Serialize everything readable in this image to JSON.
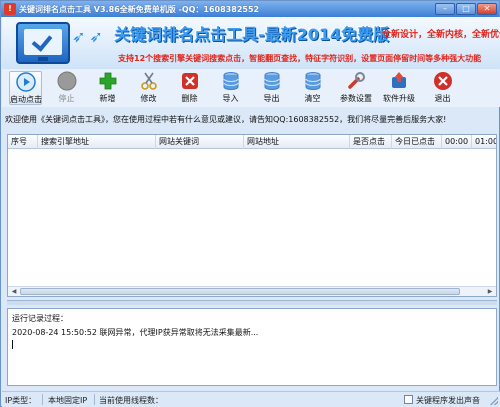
{
  "window": {
    "title": "关键词排名点击工具  V3.86全新免费单机版  -QQ：1608382552",
    "controls": {
      "minimize": "–",
      "maximize": "□",
      "close": "✕"
    }
  },
  "banner": {
    "title": "关键词排名点击工具-最新2014免费版",
    "tagline": "全新设计，全新内核，全新优化",
    "subtitle": "支持12个搜索引擎关键词搜索点击，智能翻页查找，特征字符识别，设置页面停留时间等多种强大功能"
  },
  "toolbar": {
    "items": [
      {
        "label": "启动点击",
        "icon": "play-icon",
        "color": "#1e7fd6"
      },
      {
        "label": "停止",
        "icon": "stop-icon",
        "color": "#8a8a8a"
      },
      {
        "label": "新增",
        "icon": "plus-icon",
        "color": "#2aa52a"
      },
      {
        "label": "修改",
        "icon": "scissors-icon",
        "color": "#c89a1a"
      },
      {
        "label": "删除",
        "icon": "delete-icon",
        "color": "#d0302a"
      },
      {
        "label": "导入",
        "icon": "database-import-icon",
        "color": "#3c7fd0"
      },
      {
        "label": "导出",
        "icon": "database-export-icon",
        "color": "#3c7fd0"
      },
      {
        "label": "清空",
        "icon": "database-clear-icon",
        "color": "#3c7fd0"
      },
      {
        "label": "参数设置",
        "icon": "wrench-icon",
        "color": "#cc3a2a"
      },
      {
        "label": "软件升级",
        "icon": "upgrade-icon",
        "color": "#2f6fc0"
      },
      {
        "label": "退出",
        "icon": "exit-icon",
        "color": "#d0302a"
      }
    ]
  },
  "welcome": "欢迎使用《关键词点击工具》，您在使用过程中若有什么意见或建议，请告知QQ:1608382552，我们将尽量完善后服务大家!",
  "table": {
    "columns": [
      "序号",
      "搜索引擎地址",
      "网站关键词",
      "网站地址",
      "是否点击",
      "今日已点击",
      "00:00",
      "01:00"
    ],
    "rows": []
  },
  "log": {
    "title": "运行记录过程：",
    "lines": [
      "2020-08-24 15:50:52 联网异常，代理IP获异常取将无法采集最新..."
    ]
  },
  "statusbar": {
    "ip_type_label": "IP类型：",
    "ip_type_value": "本地固定IP",
    "threads_label": "当前使用线程数：",
    "threads_value": "",
    "sound_label": "关键程序发出声音"
  }
}
